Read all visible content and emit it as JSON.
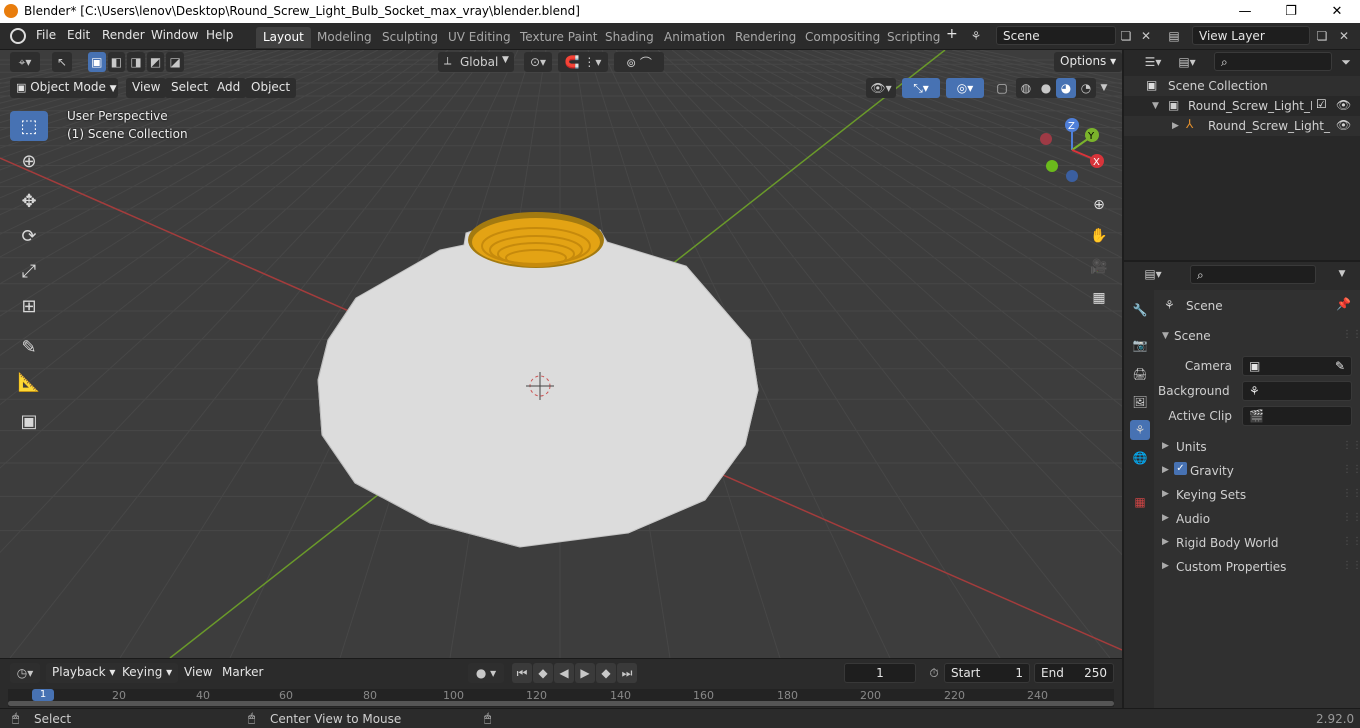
{
  "window": {
    "title": "Blender* [C:\\Users\\lenov\\Desktop\\Round_Screw_Light_Bulb_Socket_max_vray\\blender.blend]",
    "minimize": "—",
    "maximize": "❐",
    "close": "✕"
  },
  "menubar": {
    "items": [
      "File",
      "Edit",
      "Render",
      "Window",
      "Help"
    ]
  },
  "workspaces": {
    "tabs": [
      "Layout",
      "Modeling",
      "Sculpting",
      "UV Editing",
      "Texture Paint",
      "Shading",
      "Animation",
      "Rendering",
      "Compositing",
      "Scripting"
    ],
    "active": "Layout",
    "add": "+"
  },
  "scene_selector": {
    "value": "Scene"
  },
  "view_layer_selector": {
    "value": "View Layer"
  },
  "viewport": {
    "mode": "Object Mode",
    "menus": [
      "View",
      "Select",
      "Add",
      "Object"
    ],
    "transform_orientation": "Global",
    "options": "Options",
    "perspective_label": "User Perspective",
    "collection_label": "(1) Scene Collection",
    "gizmo": {
      "x": "X",
      "y": "Y",
      "z": "Z"
    },
    "colors": {
      "background": "#3d3d3d",
      "grid": "#4a4a4a",
      "x_axis": "#a33c3c",
      "y_axis": "#6a9a2a",
      "socket_body": "#dcdcdc",
      "socket_thread": "#e3a314"
    }
  },
  "toolbar": {
    "tools": [
      "select-box-icon",
      "cursor-icon",
      "move-icon",
      "rotate-icon",
      "scale-icon",
      "transform-icon",
      "annotate-icon",
      "measure-icon",
      "add-cube-icon"
    ]
  },
  "timeline": {
    "menus": [
      "Playback",
      "Keying",
      "View",
      "Marker"
    ],
    "current_frame": "1",
    "start_label": "Start",
    "start": "1",
    "end_label": "End",
    "end": "250",
    "ruler": [
      "1",
      "20",
      "40",
      "60",
      "80",
      "100",
      "120",
      "140",
      "160",
      "180",
      "200",
      "220",
      "240"
    ]
  },
  "statusbar": {
    "left": "Select",
    "middle": "Center View to Mouse",
    "version": "2.92.0"
  },
  "outliner": {
    "root": "Scene Collection",
    "items": [
      {
        "label": "Round_Screw_Light_Bulb",
        "level": 1
      },
      {
        "label": "Round_Screw_Light_",
        "level": 2
      }
    ]
  },
  "properties": {
    "context": "Scene",
    "panel": "Scene",
    "fields": [
      {
        "label": "Camera",
        "value": ""
      },
      {
        "label": "Background ...",
        "value": ""
      },
      {
        "label": "Active Clip",
        "value": ""
      }
    ],
    "sections": [
      "Units",
      "Gravity",
      "Keying Sets",
      "Audio",
      "Rigid Body World",
      "Custom Properties"
    ],
    "gravity_checked": true
  }
}
